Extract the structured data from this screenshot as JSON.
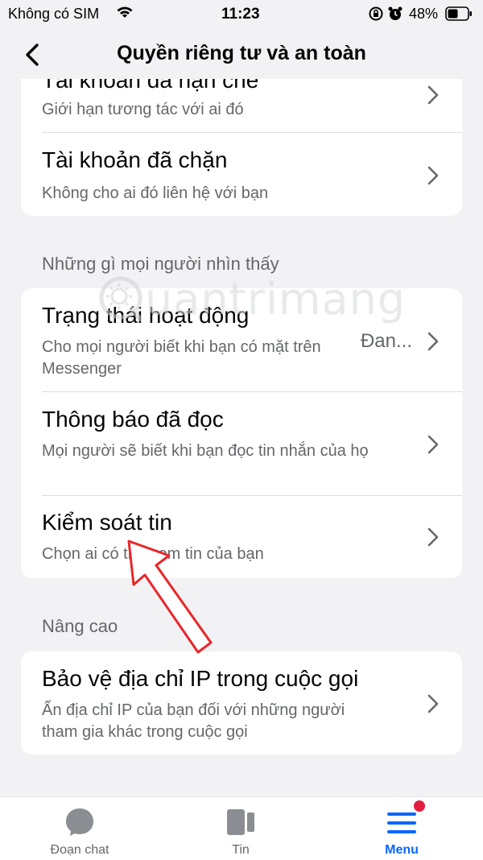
{
  "status_bar": {
    "carrier": "Không có SIM",
    "time": "11:23",
    "battery": "48%"
  },
  "header": {
    "title": "Quyền riêng tư và an toàn",
    "icons": [
      "back-chevron-icon"
    ]
  },
  "top_card": {
    "items": [
      {
        "title": "Tài khoản đã hạn chế",
        "subtitle": "Giới hạn tương tác với ai đó"
      },
      {
        "title": "Tài khoản đã chặn",
        "subtitle": "Không cho ai đó liên hệ với bạn"
      }
    ]
  },
  "visibility_section": {
    "label": "Những gì mọi người nhìn thấy",
    "items": [
      {
        "title": "Trạng thái hoạt động",
        "subtitle": "Cho mọi người biết khi bạn có mặt trên Messenger",
        "value": "Đan..."
      },
      {
        "title": "Thông báo đã đọc",
        "subtitle": "Mọi người sẽ biết khi bạn đọc tin nhắn của họ"
      },
      {
        "title": "Kiểm soát tin",
        "subtitle": "Chọn ai có thể xem tin của bạn"
      }
    ]
  },
  "advanced_section": {
    "label": "Nâng cao",
    "items": [
      {
        "title": "Bảo vệ địa chỉ IP trong cuộc gọi",
        "subtitle": "Ẩn địa chỉ IP của bạn đối với những người tham gia khác trong cuộc gọi"
      }
    ]
  },
  "watermark": {
    "text": "uantrimang"
  },
  "tabbar": {
    "tabs": [
      {
        "label": "Đoạn chat",
        "icon": "chat-bubble-icon",
        "active": false
      },
      {
        "label": "Tin",
        "icon": "stories-icon",
        "active": false
      },
      {
        "label": "Menu",
        "icon": "menu-icon",
        "active": true,
        "has_badge": true
      }
    ]
  },
  "colors": {
    "accent": "#0866ff",
    "badge": "#e41e3f",
    "annotation_arrow": "#e8262a",
    "background": "#f2f2f4"
  }
}
